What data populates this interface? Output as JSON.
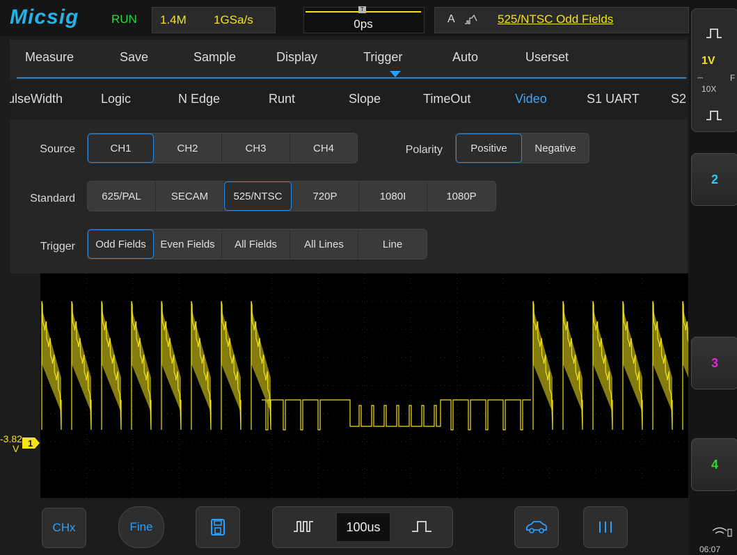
{
  "status": {
    "brand": "Micsig",
    "run_state": "RUN",
    "memory_depth": "1.4M",
    "sample_rate": "1GSa/s",
    "trigger_delay": "0ps",
    "trigger_source": "A",
    "trigger_description": "525/NTSC Odd Fields"
  },
  "menu": {
    "tabs": [
      "Measure",
      "Save",
      "Sample",
      "Display",
      "Trigger",
      "Auto",
      "Userset"
    ],
    "active_tab": "Trigger",
    "subtabs": [
      "ulseWidth",
      "Logic",
      "N Edge",
      "Runt",
      "Slope",
      "TimeOut",
      "Video",
      "S1 UART",
      "S2"
    ],
    "active_subtab": "Video",
    "source": {
      "label": "Source",
      "options": [
        "CH1",
        "CH2",
        "CH3",
        "CH4"
      ],
      "selected": "CH1"
    },
    "polarity": {
      "label": "Polarity",
      "options": [
        "Positive",
        "Negative"
      ],
      "selected": "Positive"
    },
    "standard": {
      "label": "Standard",
      "options": [
        "625/PAL",
        "SECAM",
        "525/NTSC",
        "720P",
        "1080I",
        "1080P"
      ],
      "selected": "525/NTSC"
    },
    "trigger": {
      "label": "Trigger",
      "options": [
        "Odd Fields",
        "Even Fields",
        "All Fields",
        "All Lines",
        "Line"
      ],
      "selected": "Odd Fields"
    }
  },
  "waveform": {
    "ref_level": "-3.82",
    "ref_unit": "V",
    "channel_marker": "1",
    "trace_color": "#f3e21c"
  },
  "toolbar": {
    "chx_label": "CHx",
    "fine_label": "Fine",
    "timebase": "100us"
  },
  "channels": {
    "ch1_scale": "1V",
    "ch1_probe": "10X",
    "ch1_suffix": "F",
    "ch2": "2",
    "ch3": "3",
    "ch4": "4",
    "ch2_color": "#27d0f0",
    "ch3_color": "#e02ad8",
    "ch4_color": "#2ed82e"
  },
  "clock": "06:07"
}
